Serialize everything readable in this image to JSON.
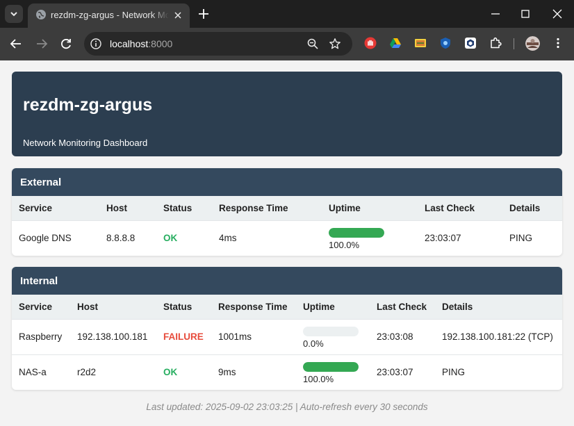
{
  "browser": {
    "tab_title": "rezdm-zg-argus - Network Monitoring Dashboard",
    "url_host": "localhost",
    "url_port": ":8000"
  },
  "page": {
    "title": "rezdm-zg-argus",
    "subtitle": "Network Monitoring Dashboard"
  },
  "sections": [
    {
      "name": "External",
      "columns": [
        "Service",
        "Host",
        "Status",
        "Response Time",
        "Uptime",
        "Last Check",
        "Details"
      ],
      "rows": [
        {
          "service": "Google DNS",
          "host": "8.8.8.8",
          "status": "OK",
          "response_time": "4ms",
          "uptime_fraction": 1.0,
          "uptime_text": "100.0%",
          "last_check": "23:03:07",
          "details": "PING"
        }
      ]
    },
    {
      "name": "Internal",
      "columns": [
        "Service",
        "Host",
        "Status",
        "Response Time",
        "Uptime",
        "Last Check",
        "Details"
      ],
      "rows": [
        {
          "service": "Raspberry",
          "host": "192.138.100.181",
          "status": "FAILURE",
          "response_time": "1001ms",
          "uptime_fraction": 0.0,
          "uptime_text": "0.0%",
          "last_check": "23:03:08",
          "details": "192.138.100.181:22 (TCP)"
        },
        {
          "service": "NAS-a",
          "host": "r2d2",
          "status": "OK",
          "response_time": "9ms",
          "uptime_fraction": 1.0,
          "uptime_text": "100.0%",
          "last_check": "23:03:07",
          "details": "PING"
        }
      ]
    }
  ],
  "footer": "Last updated: 2025-09-02 23:03:25 | Auto-refresh every 30 seconds",
  "colors": {
    "header_bg": "#2c3e50",
    "section_head_bg": "#34495e",
    "ok": "#27ae60",
    "failure": "#e74c3c",
    "uptime_bar": "#34a853"
  },
  "icons": [
    "tab-search-icon",
    "globe-icon",
    "close-icon",
    "plus-icon",
    "minimize-icon",
    "maximize-icon",
    "back-icon",
    "forward-icon",
    "reload-icon",
    "site-info-icon",
    "zoom-icon",
    "star-icon",
    "stop-extension-icon",
    "drive-icon",
    "extension-icon",
    "shield-extension-icon",
    "cube-extension-icon",
    "puzzle-icon",
    "profile-avatar",
    "more-menu-icon"
  ]
}
